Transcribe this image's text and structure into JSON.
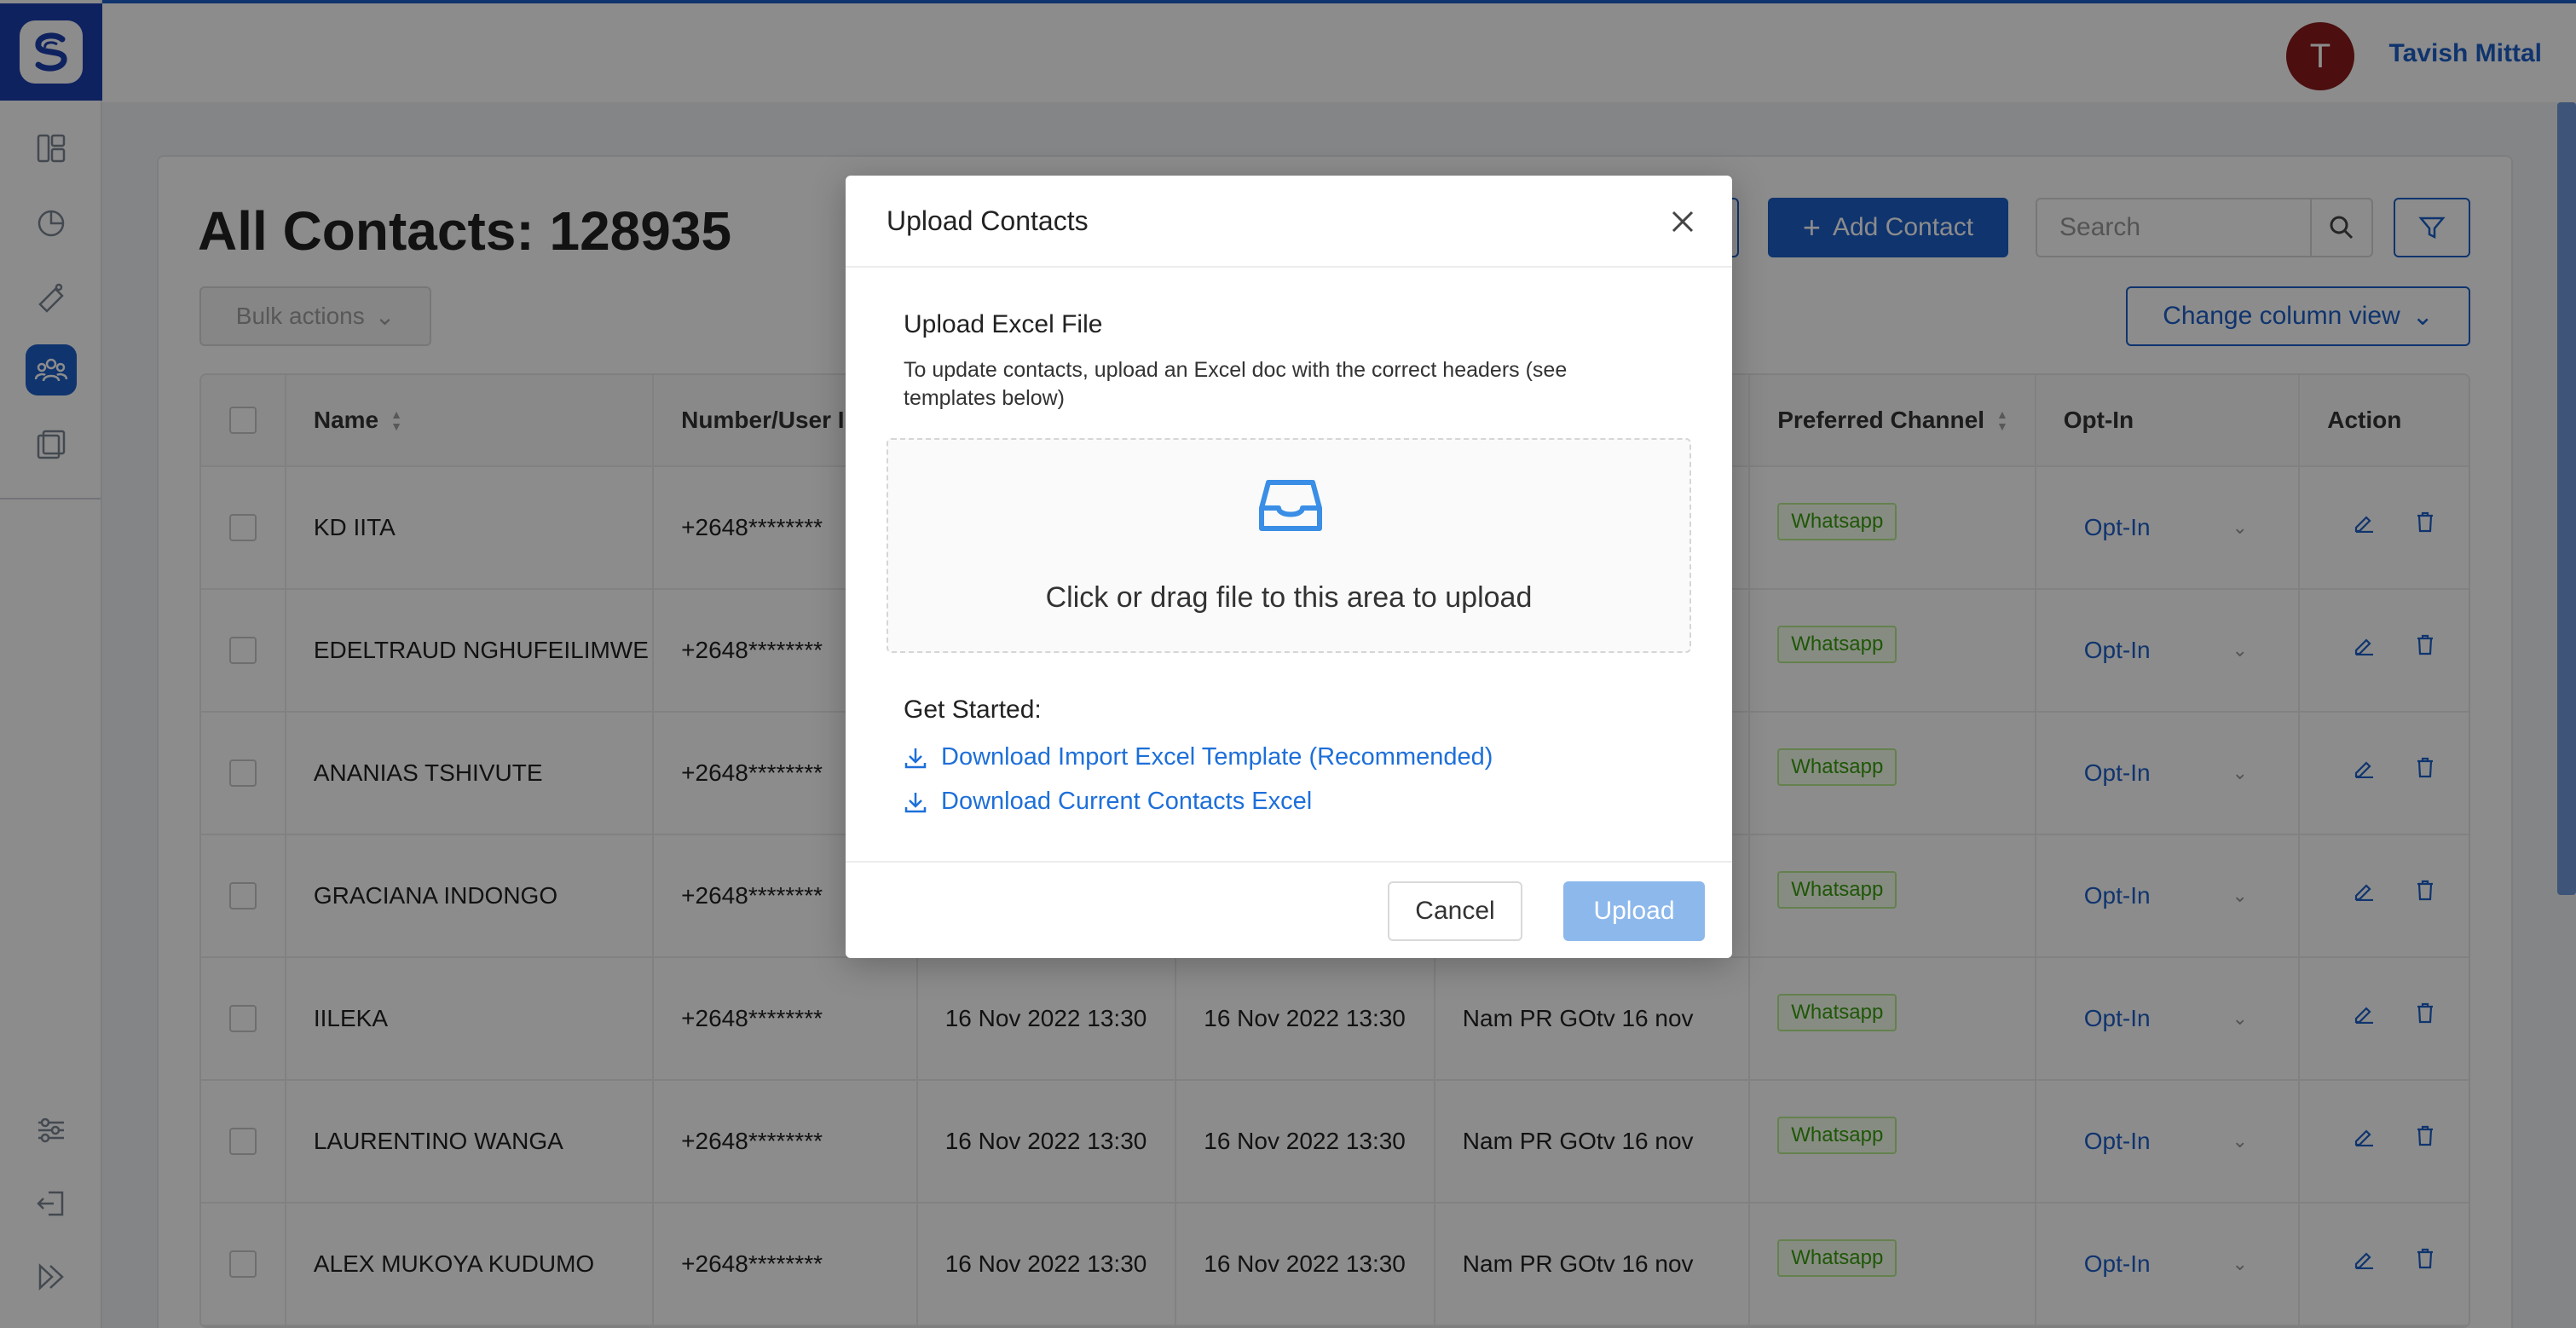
{
  "user": {
    "initial": "T",
    "name": "Tavish Mittal"
  },
  "page": {
    "title": "All Contacts: 128935",
    "bulk_actions": "Bulk actions",
    "add_contact": "Add Contact",
    "search_placeholder": "Search",
    "change_column_view": "Change column view"
  },
  "table": {
    "headers": [
      "Name",
      "Number/User ID",
      "",
      "",
      "",
      "Preferred Channel",
      "Opt-In",
      "Action"
    ],
    "rows": [
      {
        "name": "KD IITA",
        "number": "+2648********",
        "created": "",
        "updated": "",
        "source": "",
        "channel": "Whatsapp",
        "optin": "Opt-In"
      },
      {
        "name": "EDELTRAUD NGHUFEILIMWE",
        "number": "+2648********",
        "created": "",
        "updated": "",
        "source": "",
        "channel": "Whatsapp",
        "optin": "Opt-In"
      },
      {
        "name": "ANANIAS TSHIVUTE",
        "number": "+2648********",
        "created": "",
        "updated": "",
        "source": "",
        "channel": "Whatsapp",
        "optin": "Opt-In"
      },
      {
        "name": "GRACIANA INDONGO",
        "number": "+2648********",
        "created": "",
        "updated": "",
        "source": "",
        "channel": "Whatsapp",
        "optin": "Opt-In"
      },
      {
        "name": "IILEKA",
        "number": "+2648********",
        "created": "16 Nov 2022 13:30",
        "updated": "16 Nov 2022 13:30",
        "source": "Nam PR GOtv 16 nov",
        "channel": "Whatsapp",
        "optin": "Opt-In"
      },
      {
        "name": "LAURENTINO WANGA",
        "number": "+2648********",
        "created": "16 Nov 2022 13:30",
        "updated": "16 Nov 2022 13:30",
        "source": "Nam PR GOtv 16 nov",
        "channel": "Whatsapp",
        "optin": "Opt-In"
      },
      {
        "name": "ALEX MUKOYA KUDUMO",
        "number": "+2648********",
        "created": "16 Nov 2022 13:30",
        "updated": "16 Nov 2022 13:30",
        "source": "Nam PR GOtv 16 nov",
        "channel": "Whatsapp",
        "optin": "Opt-In"
      }
    ]
  },
  "modal": {
    "title": "Upload Contacts",
    "section_title": "Upload Excel File",
    "section_desc": "To update contacts, upload an Excel doc with the correct headers (see templates below)",
    "dropzone_text": "Click or drag file to this area to upload",
    "get_started": "Get Started:",
    "link_template": "Download Import Excel Template (Recommended)",
    "link_current": "Download Current Contacts Excel",
    "cancel": "Cancel",
    "upload": "Upload"
  },
  "colors": {
    "primary": "#1d5fc9",
    "link": "#1d6fd9",
    "upload_disabled": "#8db8ec",
    "whatsapp_tag": "#389e0d",
    "avatar": "#8b1a1a"
  },
  "icons": {
    "sidebar": [
      "dashboard-icon",
      "analytics-icon",
      "campaign-icon",
      "contacts-icon",
      "templates-icon",
      "settings-icon",
      "logout-icon",
      "expand-icon"
    ]
  }
}
